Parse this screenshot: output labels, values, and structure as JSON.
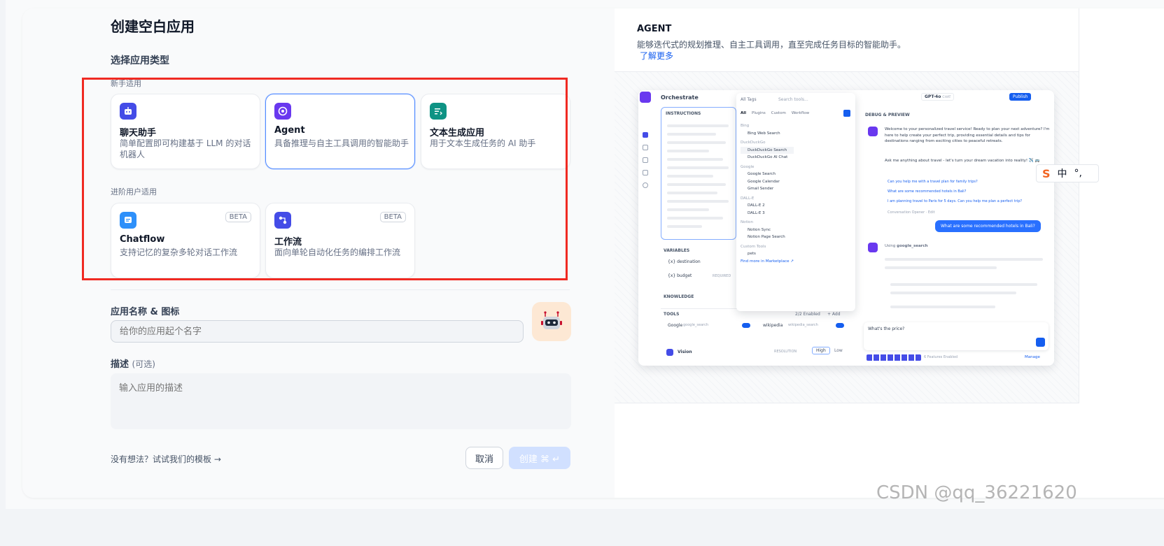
{
  "page_title": "创建空白应用",
  "select_type_label": "选择应用类型",
  "groups": {
    "beginner": "新手适用",
    "advanced": "进阶用户适用"
  },
  "cards": {
    "chat": {
      "title": "聊天助手",
      "desc": "简单配置即可构建基于 LLM 的对话机器人",
      "icon": "chat-bot-icon",
      "color": "#444ce7"
    },
    "agent": {
      "title": "Agent",
      "desc": "具备推理与自主工具调用的智能助手",
      "icon": "agent-icon",
      "color": "#6938ef"
    },
    "completion": {
      "title": "文本生成应用",
      "desc": "用于文本生成任务的 AI 助手",
      "icon": "text-generation-icon",
      "color": "#0e9384"
    },
    "chatflow": {
      "title": "Chatflow",
      "desc": "支持记忆的复杂多轮对话工作流",
      "badge": "BETA",
      "icon": "chatflow-icon",
      "color": "#2e90fa"
    },
    "workflow": {
      "title": "工作流",
      "desc": "面向单轮自动化任务的编排工作流",
      "badge": "BETA",
      "icon": "workflow-icon",
      "color": "#444ce7"
    }
  },
  "name_field": {
    "label": "应用名称 & 图标",
    "placeholder": "给你的应用起个名字"
  },
  "desc_field": {
    "label": "描述",
    "optional": "(可选)",
    "placeholder": "输入应用的描述"
  },
  "template_link": "没有想法？试试我们的模板 →",
  "cancel_label": "取消",
  "create_label": "创建 ⌘ ↵",
  "right_panel": {
    "title": "AGENT",
    "desc": "能够迭代式的规划推理、自主工具调用，直至完成任务目标的智能助手。",
    "learn_more": "了解更多"
  },
  "preview": {
    "orchestrate": "Orchestrate",
    "instructions": "INSTRUCTIONS",
    "variables": "VARIABLES",
    "var_destination": "{x} destination",
    "var_budget": "{x} budget",
    "required": "REQUIRED",
    "knowledge": "KNOWLEDGE",
    "tools": "TOOLS",
    "tools_enabled": "2/2 Enabled",
    "add": "+ Add",
    "tool_google": "Google",
    "tool_google_sub": "google_search",
    "tool_wikipedia": "wikipedia",
    "tool_wikipedia_sub": "wikipedia_search",
    "vision": "Vision",
    "resolution": "RESOLUTION",
    "high": "High",
    "low": "Low",
    "all_tags": "All Tags",
    "search_tools": "Search tools...",
    "filter_tabs": [
      "All",
      "Plugins",
      "Custom",
      "Workflow"
    ],
    "tool_list": [
      {
        "group": "Bing",
        "items": [
          "Bing Web Search"
        ]
      },
      {
        "group": "DuckDuckGo",
        "items": [
          "DuckDuckGo Search",
          "DuckDuckGo AI Chat"
        ]
      },
      {
        "group": "Google",
        "items": [
          "Google Search",
          "Google Calendar",
          "Gmail Sender"
        ]
      },
      {
        "group": "DALL-E",
        "items": [
          "DALL-E 2",
          "DALL-E 3"
        ]
      },
      {
        "group": "Notion",
        "items": [
          "Notion Sync",
          "Notion Page Search"
        ]
      },
      {
        "group": "Custom Tools",
        "items": [
          "pets"
        ]
      }
    ],
    "find_more": "Find more in Marketplace ↗",
    "model": "GPT-4o",
    "model_tag": "CHAT",
    "publish": "Publish",
    "debug": "DEBUG & PREVIEW",
    "welcome": "Welcome to your personalized travel service! Ready to plan your next adventure? I'm here to help create your perfect trip, providing essential details and tips for destinations ranging from exciting cities to peaceful retreats.",
    "ask": "Ask me anything about travel - let's turn your dream vacation into reality! ✈️ 🚌",
    "suggestions": [
      "Can you help me with a travel plan for family trips?",
      "What are some recommended hotels in Bali?",
      "I am planning travel to Paris for 5 days. Can you help me plan a perfect trip?"
    ],
    "opener": "Conversation Opener · Edit",
    "user_msg": "What are some recommended hotels in Bali?",
    "using": "Using",
    "using_tool": "google_search",
    "input_text": "What's the price?",
    "features": "6 Features Enabled",
    "manage": "Manage"
  },
  "ime": {
    "s": "S",
    "lang": "中",
    "punct": "°,"
  },
  "watermark": "CSDN @qq_36221620"
}
